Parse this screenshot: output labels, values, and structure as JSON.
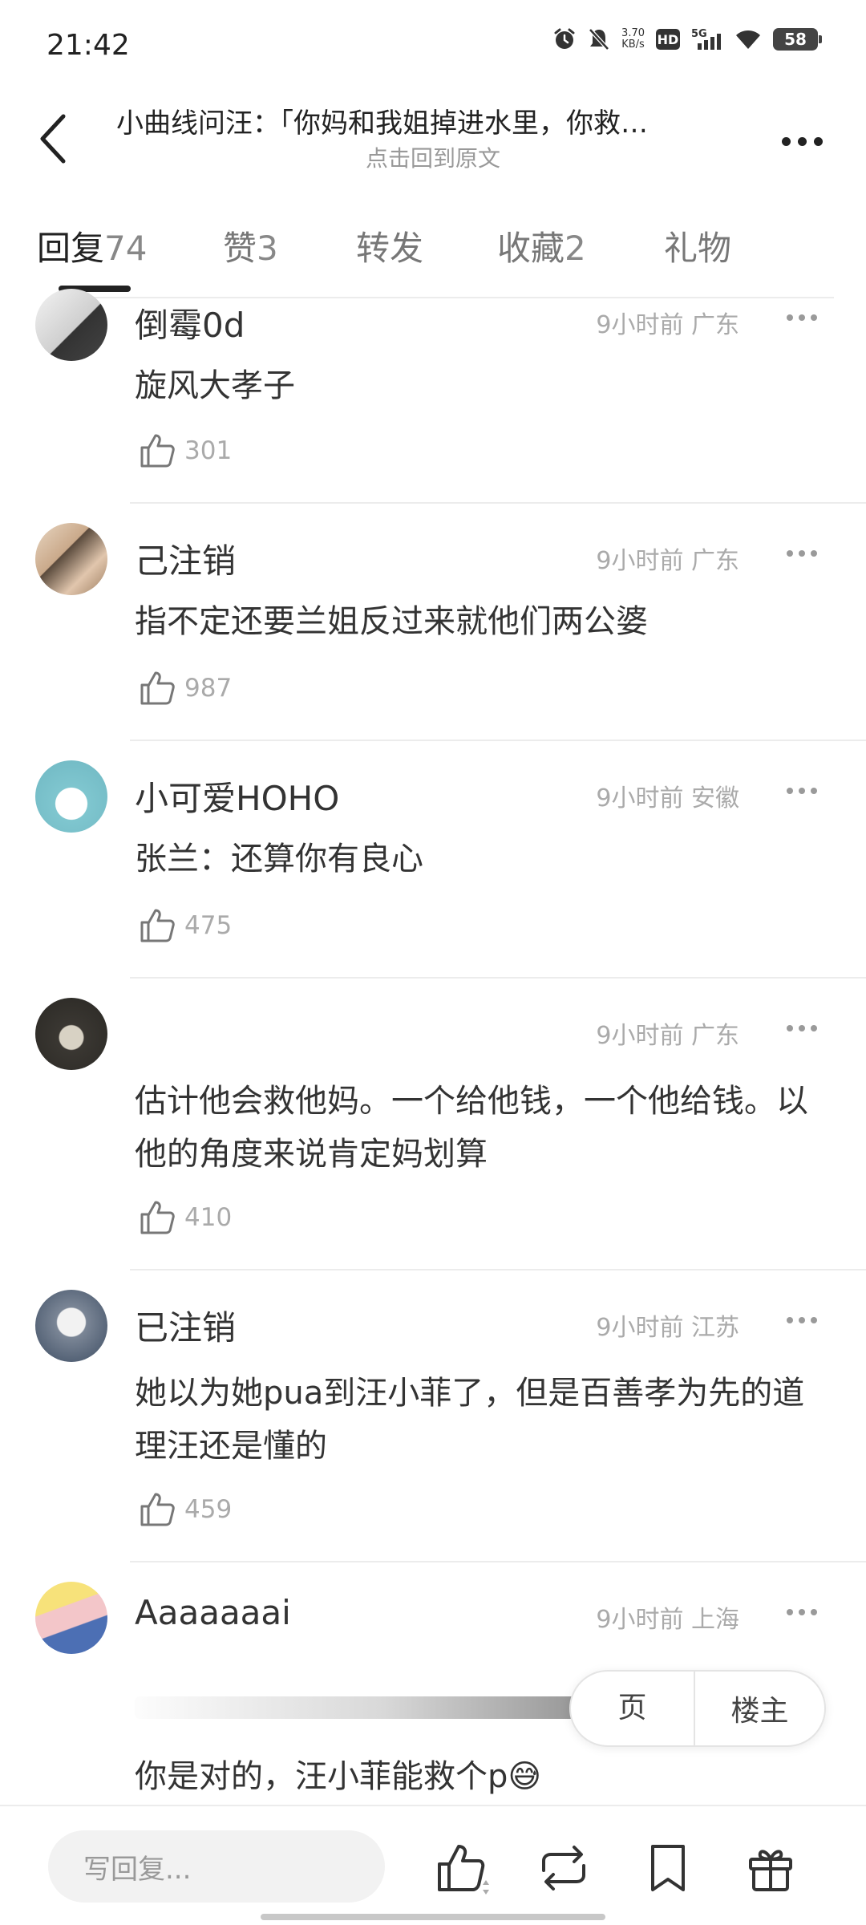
{
  "status_bar": {
    "time": "21:42",
    "net_speed_value": "3.70",
    "net_speed_unit": "KB/s",
    "hd": "HD",
    "signal": "5G",
    "battery": "58"
  },
  "header": {
    "title": "小曲线问汪：「你妈和我姐掉进水里，你救…",
    "subtitle": "点击回到原文"
  },
  "tabs": [
    {
      "label": "回复",
      "count": "74"
    },
    {
      "label": "赞",
      "count": "3"
    },
    {
      "label": "转发",
      "count": ""
    },
    {
      "label": "收藏",
      "count": "2"
    },
    {
      "label": "礼物",
      "count": ""
    }
  ],
  "comments": [
    {
      "name": "倒霉0d",
      "meta": "9小时前 广东",
      "text": "旋风大孝子",
      "likes": "301"
    },
    {
      "name": "己注销",
      "meta": "9小时前 广东",
      "text": "指不定还要兰姐反过来就他们两公婆",
      "likes": "987"
    },
    {
      "name": "小可爱HOHO",
      "meta": "9小时前 安徽",
      "text": "张兰：还算你有良心",
      "likes": "475"
    },
    {
      "name": "",
      "meta": "9小时前 广东",
      "text": "估计他会救他妈。一个给他钱，一个他给钱。以他的角度来说肯定妈划算",
      "likes": "410"
    },
    {
      "name": "已注销",
      "meta": "9小时前 江苏",
      "text": "她以为她pua到汪小菲了，但是百善孝为先的道理汪还是懂的",
      "likes": "459"
    },
    {
      "name": "Aaaaaaai",
      "meta": "9小时前 上海",
      "text": "你是对的，汪小菲能救个p😅",
      "likes": ""
    }
  ],
  "float_control": {
    "page": "页",
    "owner": "楼主"
  },
  "bottom_bar": {
    "reply_placeholder": "写回复..."
  }
}
